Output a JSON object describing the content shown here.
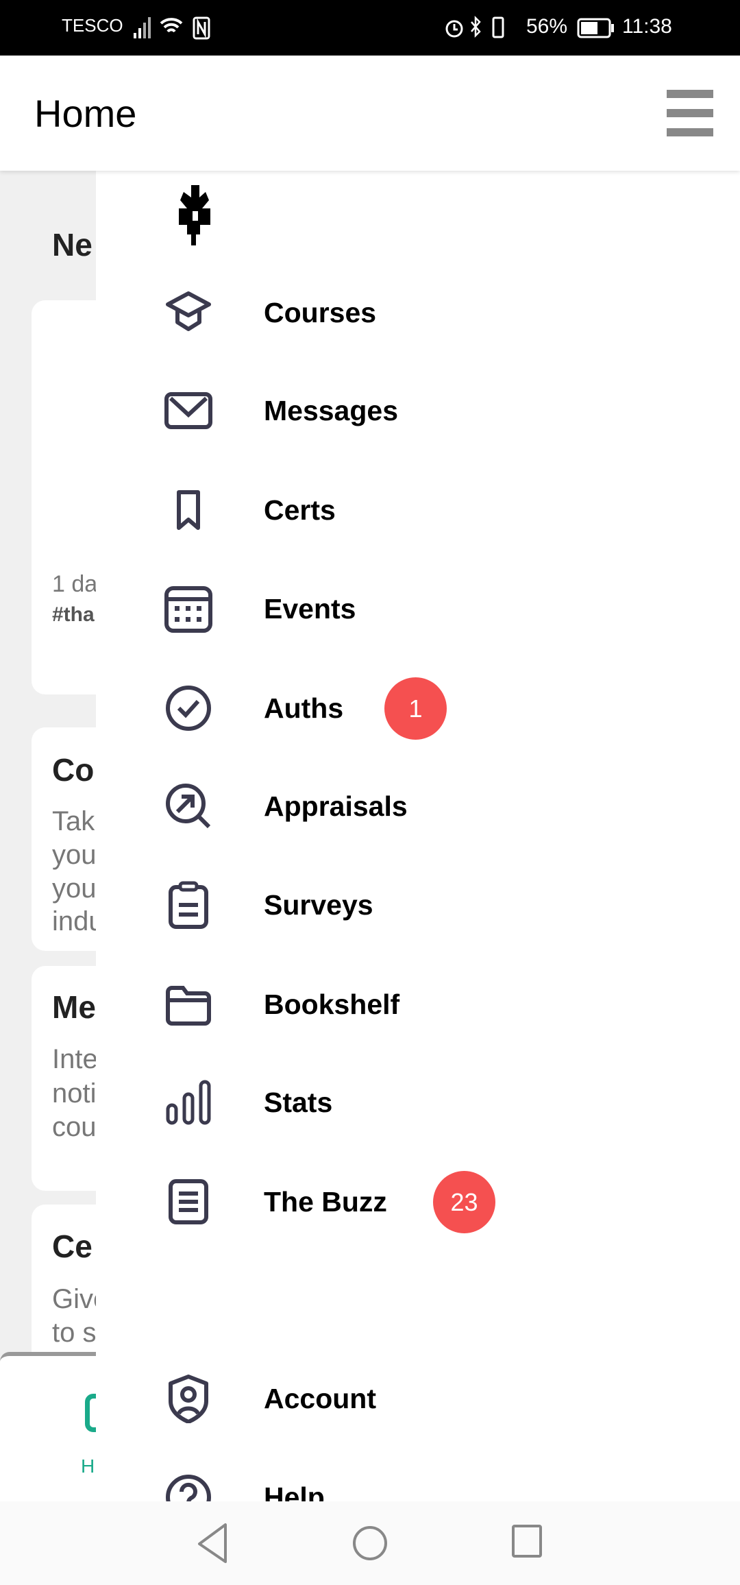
{
  "status_bar": {
    "carrier": "TESCO",
    "battery": "56%",
    "time": "11:38"
  },
  "app_bar": {
    "title": "Home",
    "menu_icon": "hamburger-icon"
  },
  "background": {
    "section_heading": "Ne",
    "card1": {
      "time": "1 da",
      "tag": "#tha"
    },
    "card2": {
      "title": "Co",
      "lines": [
        "Tak",
        "you",
        "you",
        "indu"
      ]
    },
    "card3": {
      "title": "Me",
      "lines": [
        "Inte",
        "noti",
        "cou"
      ]
    },
    "card4": {
      "title": "Ce",
      "lines": [
        "Give",
        "to s"
      ]
    },
    "tab_label": "H"
  },
  "drawer": {
    "items": [
      {
        "label": "Courses",
        "icon": "graduation-cap-icon"
      },
      {
        "label": "Messages",
        "icon": "envelope-icon"
      },
      {
        "label": "Certs",
        "icon": "bookmark-icon"
      },
      {
        "label": "Events",
        "icon": "calendar-icon"
      },
      {
        "label": "Auths",
        "icon": "check-circle-icon",
        "badge": "1"
      },
      {
        "label": "Appraisals",
        "icon": "search-arrow-icon"
      },
      {
        "label": "Surveys",
        "icon": "clipboard-icon"
      },
      {
        "label": "Bookshelf",
        "icon": "folder-icon"
      },
      {
        "label": "Stats",
        "icon": "bar-chart-icon"
      },
      {
        "label": "The Buzz",
        "icon": "document-icon",
        "badge": "23"
      },
      {
        "label": "Account",
        "icon": "shield-user-icon"
      },
      {
        "label": "Help",
        "icon": "help-circle-icon"
      }
    ]
  },
  "colors": {
    "icon": "#3b3a4e",
    "badge": "#f55050",
    "accent": "#1aaa8a"
  }
}
